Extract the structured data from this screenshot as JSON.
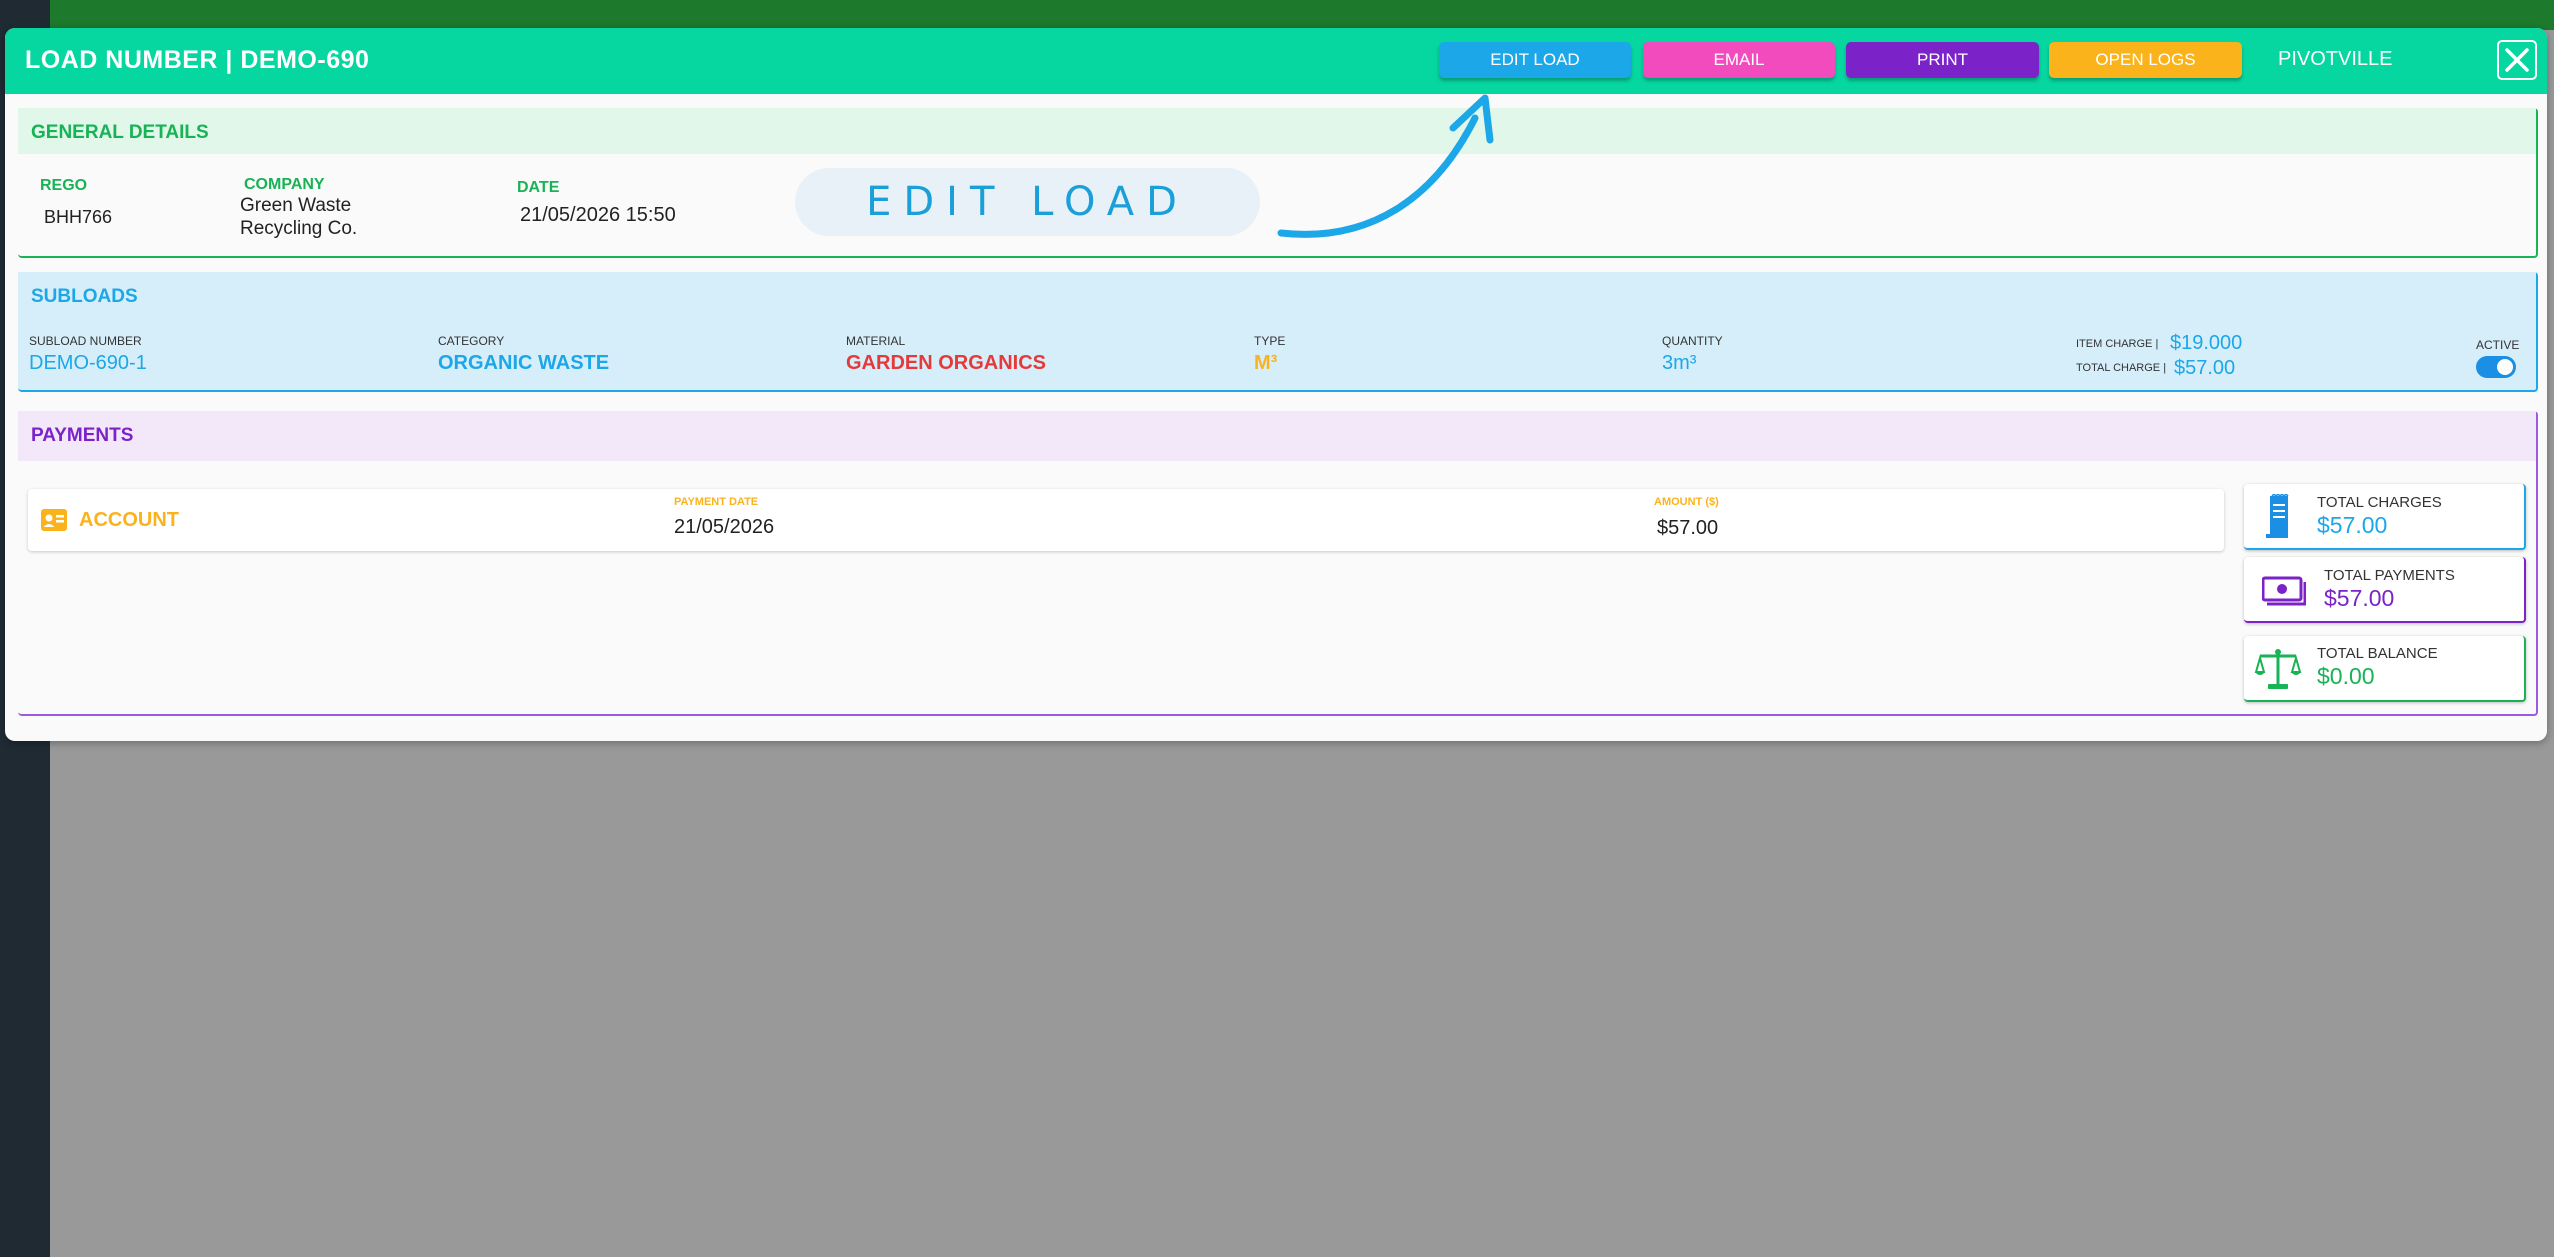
{
  "header": {
    "title": "LOAD NUMBER | DEMO-690",
    "edit_button": "EDIT LOAD",
    "email_button": "EMAIL",
    "print_button": "PRINT",
    "logs_button": "OPEN LOGS",
    "site_name": "PIVOTVILLE",
    "colors": {
      "header": "#06d6a0",
      "edit": "#1ba7e8",
      "email": "#f24bbd",
      "print": "#7b22c9",
      "logs": "#fbb31c"
    }
  },
  "general": {
    "title": "GENERAL DETAILS",
    "rego_label": "REGO",
    "rego": "BHH766",
    "company_label": "COMPANY",
    "company_line1": "Green Waste",
    "company_line2": "Recycling Co.",
    "date_label": "DATE",
    "date": "21/05/2026 15:50",
    "edit_callout": "EDIT LOAD",
    "color": "#17b355"
  },
  "subloads": {
    "title": "SUBLOADS",
    "color": "#1ba7e8",
    "row": {
      "number_label": "SUBLOAD NUMBER",
      "number": "DEMO-690-1",
      "category_label": "CATEGORY",
      "category": "ORGANIC WASTE",
      "material_label": "MATERIAL",
      "material": "GARDEN ORGANICS",
      "type_label": "TYPE",
      "type": "M³",
      "quantity_label": "QUANTITY",
      "quantity": "3m³",
      "item_charge_label": "ITEM CHARGE |",
      "item_charge": "$19.000",
      "total_charge_label": "TOTAL CHARGE |",
      "total_charge": "$57.00",
      "active_label": "ACTIVE",
      "active": true
    }
  },
  "payments": {
    "title": "PAYMENTS",
    "color": "#7b22c9",
    "row": {
      "method": "ACCOUNT",
      "date_label": "PAYMENT DATE",
      "date": "21/05/2026",
      "amount_label": "AMOUNT ($)",
      "amount": "$57.00"
    },
    "totals": {
      "charges_label": "TOTAL CHARGES",
      "charges": "$57.00",
      "payments_label": "TOTAL PAYMENTS",
      "payments": "$57.00",
      "balance_label": "TOTAL BALANCE",
      "balance": "$0.00"
    }
  }
}
